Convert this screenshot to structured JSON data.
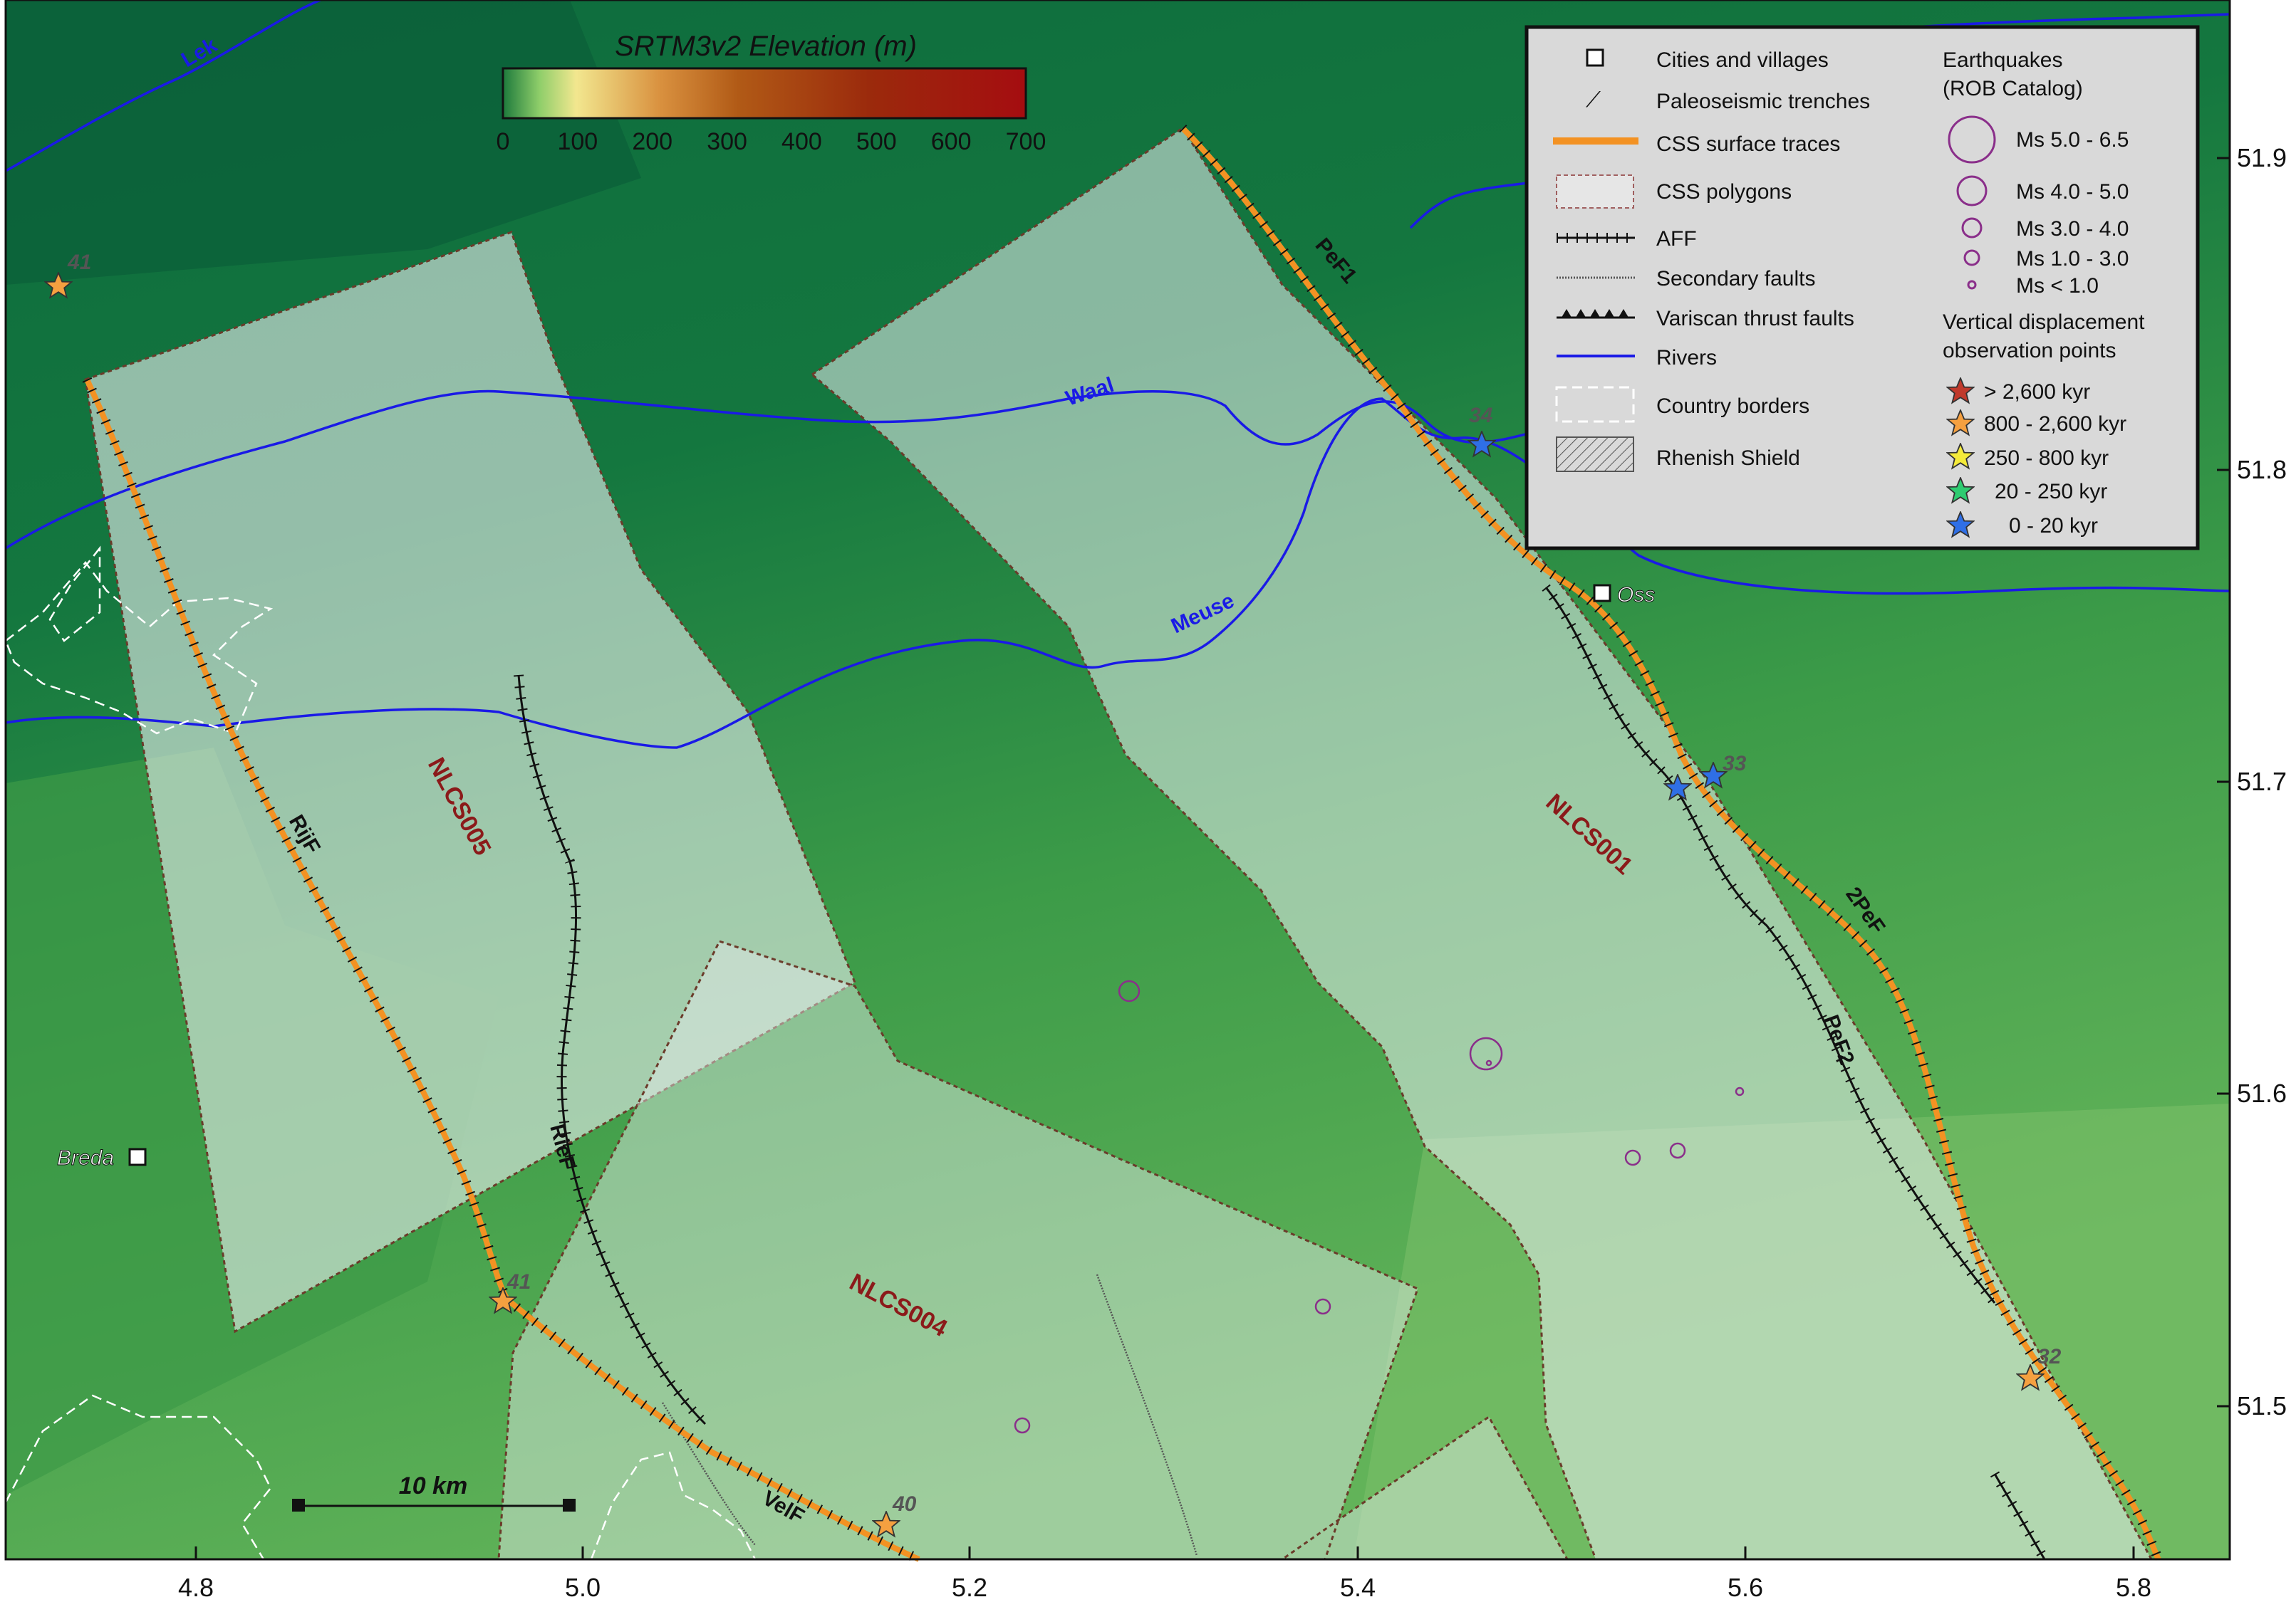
{
  "colorbar": {
    "title": "SRTM3v2 Elevation (m)",
    "ticks": [
      "0",
      "100",
      "200",
      "300",
      "400",
      "500",
      "600",
      "700"
    ]
  },
  "axes": {
    "x_ticks": [
      "4.8",
      "5.0",
      "5.2",
      "5.4",
      "5.6",
      "5.8"
    ],
    "y_ticks": [
      "51.9",
      "51.8",
      "51.7",
      "51.6",
      "51.5"
    ]
  },
  "legend": {
    "items": {
      "cities": "Cities and villages",
      "trenches": "Paleoseismic trenches",
      "css_traces": "CSS surface traces",
      "css_polygons": "CSS polygons",
      "aff": "AFF",
      "secondary": "Secondary faults",
      "variscan": "Variscan thrust faults",
      "rivers": "Rivers",
      "borders": "Country borders",
      "rhenish": "Rhenish Shield"
    },
    "eq_title_1": "Earthquakes",
    "eq_title_2": "(ROB Catalog)",
    "eq_classes": [
      "Ms 5.0 - 6.5",
      "Ms 4.0 - 5.0",
      "Ms 3.0 - 4.0",
      "Ms 1.0 - 3.0",
      "Ms < 1.0"
    ],
    "vd_title_1": "Vertical displacement",
    "vd_title_2": "observation points",
    "vd_classes": [
      "> 2,600 kyr",
      "800 - 2,600 kyr",
      "250 - 800 kyr",
      "20 - 250 kyr",
      "0 - 20 kyr"
    ]
  },
  "colors": {
    "css_trace": "#f39223",
    "river": "#1a1ae6",
    "source_label": "#8b1a1a",
    "quake": "#8a2f8a",
    "star_old": "#c0392b",
    "star_800": "#f5a040",
    "star_250": "#f4ea3a",
    "star_20": "#2ecc71",
    "star_young": "#2f6fe6"
  },
  "sources": [
    "NLCS005",
    "NLCS001",
    "NLCS004"
  ],
  "faults": [
    "PeF1",
    "2PeF",
    "PeF2",
    "RijF",
    "RieF",
    "VelF"
  ],
  "rivers": [
    "Lek",
    "Waal",
    "Meuse"
  ],
  "cities": [
    "Oss",
    "Breda"
  ],
  "observation_ids": [
    "34",
    "33",
    "41",
    "40",
    "32",
    "41"
  ],
  "scale_bar": "10 km"
}
